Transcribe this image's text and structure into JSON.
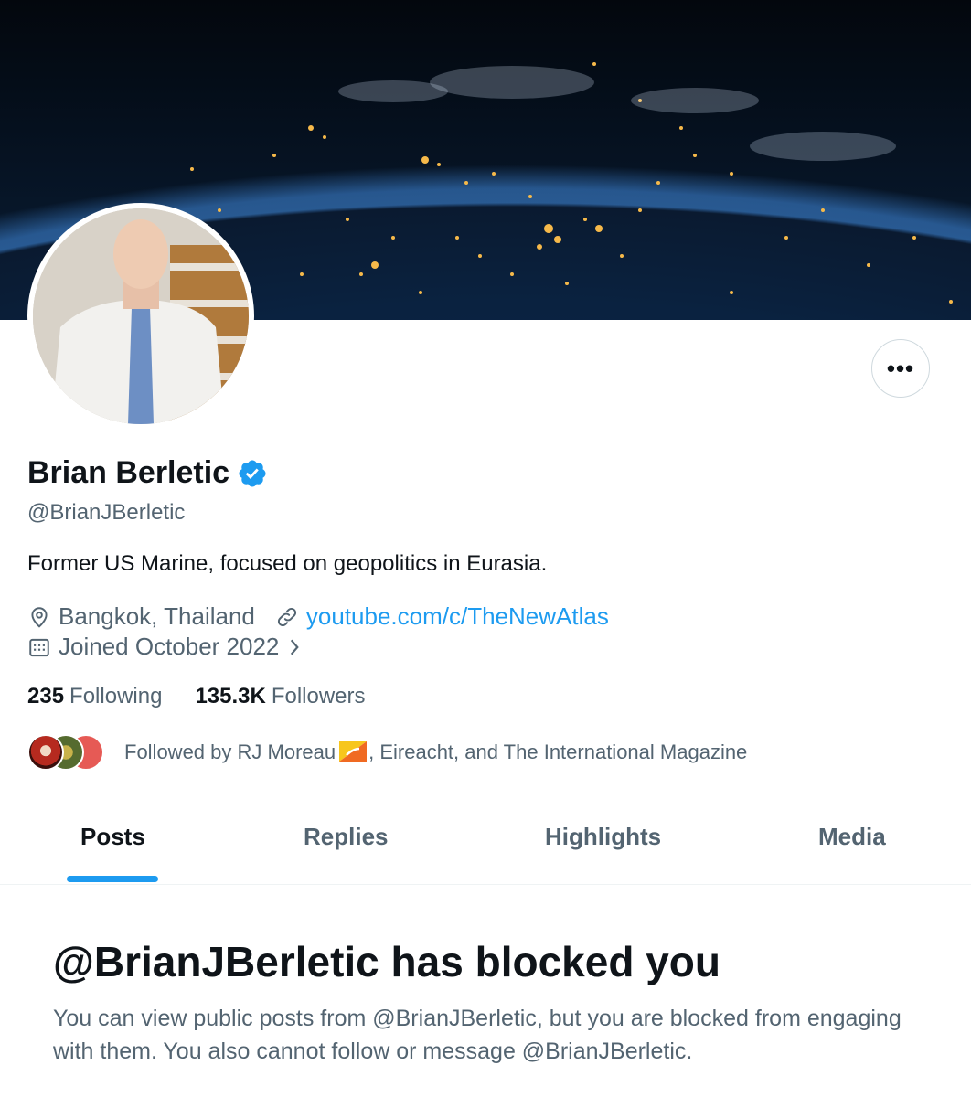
{
  "profile": {
    "name": "Brian Berletic",
    "handle": "@BrianJBerletic",
    "bio": "Former US Marine, focused on geopolitics in Eurasia.",
    "location": "Bangkok, Thailand",
    "website": "youtube.com/c/TheNewAtlas",
    "joined": "Joined October 2022",
    "verified": true,
    "more_label": "•••"
  },
  "stats": {
    "following_count": "235",
    "following_label": "Following",
    "followers_count": "135.3K",
    "followers_label": "Followers"
  },
  "followed_by": {
    "prefix": "Followed by RJ Moreau",
    "suffix": ", Eireacht, and The International Magazine"
  },
  "tabs": [
    {
      "label": "Posts",
      "active": true
    },
    {
      "label": "Replies",
      "active": false
    },
    {
      "label": "Highlights",
      "active": false
    },
    {
      "label": "Media",
      "active": false
    }
  ],
  "blocked": {
    "title": "@BrianJBerletic has blocked you",
    "message": "You can view public posts from @BrianJBerletic, but you are blocked from engaging with them. You also cannot follow or message @BrianJBerletic."
  },
  "colors": {
    "accent": "#1d9bf0",
    "text_primary": "#0f1419",
    "text_secondary": "#536471",
    "border": "#cfd9de"
  },
  "icons": [
    "location-icon",
    "link-icon",
    "calendar-icon",
    "chevron-right-icon",
    "verified-badge-icon",
    "more-icon"
  ]
}
